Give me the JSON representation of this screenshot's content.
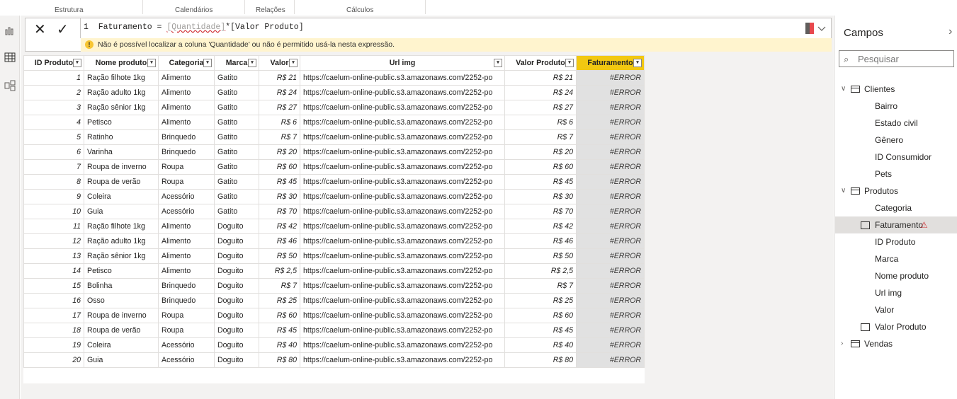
{
  "ribbon": {
    "groups": [
      "Estrutura",
      "Calendários",
      "Relações",
      "Cálculos"
    ]
  },
  "leftnav": {
    "icons": [
      "report-view-icon",
      "data-view-icon",
      "model-view-icon"
    ]
  },
  "formula": {
    "line_number": "1",
    "measure_name": "Faturamento",
    "equals": " = ",
    "bad_ref": "[Quantidade]",
    "operator": "*",
    "good_ref": "[Valor Produto]",
    "warning": "Não é possível localizar a coluna 'Quantidade' ou não é permitido usá-la nesta expressão."
  },
  "table": {
    "columns": [
      "ID Produto",
      "Nome produto",
      "Categoria",
      "Marca",
      "Valor",
      "Url img",
      "Valor Produto",
      "Faturamento"
    ],
    "rows": [
      [
        "1",
        "Ração filhote 1kg",
        "Alimento",
        "Gatito",
        "R$ 21",
        "https://caelum-online-public.s3.amazonaws.com/2252-po",
        "R$ 21",
        "#ERROR"
      ],
      [
        "2",
        "Ração adulto 1kg",
        "Alimento",
        "Gatito",
        "R$ 24",
        "https://caelum-online-public.s3.amazonaws.com/2252-po",
        "R$ 24",
        "#ERROR"
      ],
      [
        "3",
        "Ração sênior 1kg",
        "Alimento",
        "Gatito",
        "R$ 27",
        "https://caelum-online-public.s3.amazonaws.com/2252-po",
        "R$ 27",
        "#ERROR"
      ],
      [
        "4",
        "Petisco",
        "Alimento",
        "Gatito",
        "R$ 6",
        "https://caelum-online-public.s3.amazonaws.com/2252-po",
        "R$ 6",
        "#ERROR"
      ],
      [
        "5",
        "Ratinho",
        "Brinquedo",
        "Gatito",
        "R$ 7",
        "https://caelum-online-public.s3.amazonaws.com/2252-po",
        "R$ 7",
        "#ERROR"
      ],
      [
        "6",
        "Varinha",
        "Brinquedo",
        "Gatito",
        "R$ 20",
        "https://caelum-online-public.s3.amazonaws.com/2252-po",
        "R$ 20",
        "#ERROR"
      ],
      [
        "7",
        "Roupa de inverno",
        "Roupa",
        "Gatito",
        "R$ 60",
        "https://caelum-online-public.s3.amazonaws.com/2252-po",
        "R$ 60",
        "#ERROR"
      ],
      [
        "8",
        "Roupa de verão",
        "Roupa",
        "Gatito",
        "R$ 45",
        "https://caelum-online-public.s3.amazonaws.com/2252-po",
        "R$ 45",
        "#ERROR"
      ],
      [
        "9",
        "Coleira",
        "Acessório",
        "Gatito",
        "R$ 30",
        "https://caelum-online-public.s3.amazonaws.com/2252-po",
        "R$ 30",
        "#ERROR"
      ],
      [
        "10",
        "Guia",
        "Acessório",
        "Gatito",
        "R$ 70",
        "https://caelum-online-public.s3.amazonaws.com/2252-po",
        "R$ 70",
        "#ERROR"
      ],
      [
        "11",
        "Ração filhote 1kg",
        "Alimento",
        "Doguito",
        "R$ 42",
        "https://caelum-online-public.s3.amazonaws.com/2252-po",
        "R$ 42",
        "#ERROR"
      ],
      [
        "12",
        "Ração adulto 1kg",
        "Alimento",
        "Doguito",
        "R$ 46",
        "https://caelum-online-public.s3.amazonaws.com/2252-po",
        "R$ 46",
        "#ERROR"
      ],
      [
        "13",
        "Ração sênior 1kg",
        "Alimento",
        "Doguito",
        "R$ 50",
        "https://caelum-online-public.s3.amazonaws.com/2252-po",
        "R$ 50",
        "#ERROR"
      ],
      [
        "14",
        "Petisco",
        "Alimento",
        "Doguito",
        "R$ 2,5",
        "https://caelum-online-public.s3.amazonaws.com/2252-po",
        "R$ 2,5",
        "#ERROR"
      ],
      [
        "15",
        "Bolinha",
        "Brinquedo",
        "Doguito",
        "R$ 7",
        "https://caelum-online-public.s3.amazonaws.com/2252-po",
        "R$ 7",
        "#ERROR"
      ],
      [
        "16",
        "Osso",
        "Brinquedo",
        "Doguito",
        "R$ 25",
        "https://caelum-online-public.s3.amazonaws.com/2252-po",
        "R$ 25",
        "#ERROR"
      ],
      [
        "17",
        "Roupa de inverno",
        "Roupa",
        "Doguito",
        "R$ 60",
        "https://caelum-online-public.s3.amazonaws.com/2252-po",
        "R$ 60",
        "#ERROR"
      ],
      [
        "18",
        "Roupa de verão",
        "Roupa",
        "Doguito",
        "R$ 45",
        "https://caelum-online-public.s3.amazonaws.com/2252-po",
        "R$ 45",
        "#ERROR"
      ],
      [
        "19",
        "Coleira",
        "Acessório",
        "Doguito",
        "R$ 40",
        "https://caelum-online-public.s3.amazonaws.com/2252-po",
        "R$ 40",
        "#ERROR"
      ],
      [
        "20",
        "Guia",
        "Acessório",
        "Doguito",
        "R$ 80",
        "https://caelum-online-public.s3.amazonaws.com/2252-po",
        "R$ 80",
        "#ERROR"
      ]
    ]
  },
  "fields_pane": {
    "title": "Campos",
    "search_placeholder": "Pesquisar",
    "tables": [
      {
        "name": "Clientes",
        "expanded": true,
        "fields": [
          "Bairro",
          "Estado civil",
          "Gênero",
          "ID Consumidor",
          "Pets"
        ]
      },
      {
        "name": "Produtos",
        "expanded": true,
        "fields": [
          "Categoria",
          "Faturamento",
          "ID Produto",
          "Marca",
          "Nome produto",
          "Url img",
          "Valor",
          "Valor Produto"
        ]
      },
      {
        "name": "Vendas",
        "expanded": false,
        "fields": []
      }
    ]
  },
  "colors": {
    "selected_header": "#f2c811",
    "error_cell": "#e1e1e1",
    "warning_bar": "#fff4ce"
  }
}
